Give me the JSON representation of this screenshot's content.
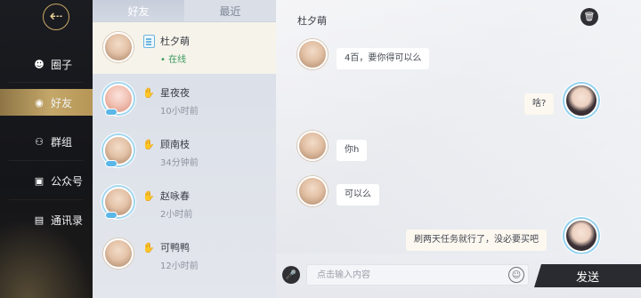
{
  "sidebar": {
    "back_glyph": "⇠",
    "items": [
      {
        "label": "圈子",
        "icon": "circle-chat-icon",
        "glyph": "☻"
      },
      {
        "label": "好友",
        "icon": "friend-icon",
        "glyph": "◉"
      },
      {
        "label": "群组",
        "icon": "group-icon",
        "glyph": "⚇"
      },
      {
        "label": "公众号",
        "icon": "image-icon",
        "glyph": "▣"
      },
      {
        "label": "通讯录",
        "icon": "contacts-icon",
        "glyph": "▤"
      }
    ],
    "active_index": 1,
    "accent": "#c4a769"
  },
  "list": {
    "tabs": [
      {
        "label": "好友"
      },
      {
        "label": "最近"
      }
    ],
    "active_tab": 0,
    "friends": [
      {
        "name": "杜夕萌",
        "status": "• 在线",
        "online": true,
        "icon": "card-icon"
      },
      {
        "name": "星夜夜",
        "status": "10小时前",
        "online": false,
        "icon": "handshake-icon"
      },
      {
        "name": "顾南枝",
        "status": "34分钟前",
        "online": false,
        "icon": "handshake-icon"
      },
      {
        "name": "赵咏春",
        "status": "2小时前",
        "online": false,
        "icon": "handshake-icon"
      },
      {
        "name": "可鸭鸭",
        "status": "12小时前",
        "online": false,
        "icon": "handshake-icon"
      }
    ]
  },
  "chat": {
    "title": "杜夕萌",
    "trash_glyph": "🗑",
    "messages": [
      {
        "from": "them",
        "text": "4百，要你得可以么"
      },
      {
        "from": "me",
        "text": "啥?"
      },
      {
        "from": "them",
        "text": "你h"
      },
      {
        "from": "them",
        "text": "可以么"
      },
      {
        "from": "me",
        "text": "刷两天任务就行了，没必要买吧"
      }
    ]
  },
  "input": {
    "mic_glyph": "🎤",
    "placeholder": "点击输入内容",
    "emoji_glyph": "☺",
    "send_label": "发送"
  }
}
